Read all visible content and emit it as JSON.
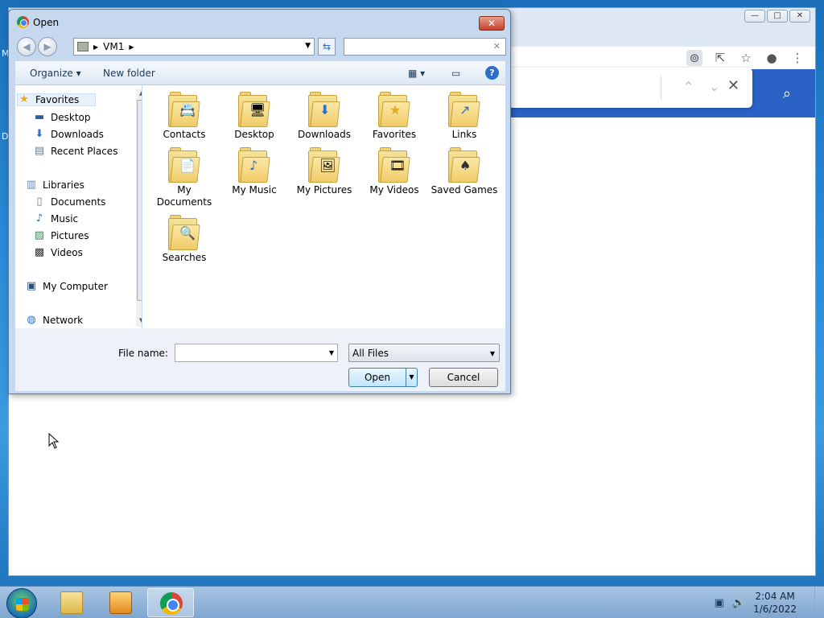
{
  "desktop": {
    "left_letters": [
      "M",
      "D"
    ]
  },
  "chrome_window": {
    "caption": {
      "minimize": "—",
      "maximize": "□",
      "close": "✕"
    },
    "toolbar_icons": [
      "zoom-icon",
      "share-icon",
      "star-icon",
      "profile-icon",
      "menu-icon"
    ],
    "findbar": {
      "up": "⌃",
      "down": "⌄",
      "close": "✕"
    }
  },
  "dialog": {
    "title": "Open",
    "close": "✕",
    "breadcrumb": {
      "location": "VM1"
    },
    "search_placeholder": "",
    "command_bar": {
      "organize": "Organize",
      "new_folder": "New folder",
      "help": "?"
    },
    "nav_pane": {
      "favorites": "Favorites",
      "favorites_items": [
        "Desktop",
        "Downloads",
        "Recent Places"
      ],
      "libraries": "Libraries",
      "libraries_items": [
        "Documents",
        "Music",
        "Pictures",
        "Videos"
      ],
      "computer": "My Computer",
      "network": "Network"
    },
    "folders": [
      {
        "name": "Contacts",
        "glyph": "📇"
      },
      {
        "name": "Desktop",
        "glyph": "🖥"
      },
      {
        "name": "Downloads",
        "glyph": "⬇"
      },
      {
        "name": "Favorites",
        "glyph": "★"
      },
      {
        "name": "Links",
        "glyph": "↗"
      },
      {
        "name": "My Documents",
        "glyph": "📄"
      },
      {
        "name": "My Music",
        "glyph": "♪"
      },
      {
        "name": "My Pictures",
        "glyph": "🖼"
      },
      {
        "name": "My Videos",
        "glyph": "🎞"
      },
      {
        "name": "Saved Games",
        "glyph": "♠"
      },
      {
        "name": "Searches",
        "glyph": "🔍"
      }
    ],
    "file_name_label": "File name:",
    "file_name_value": "",
    "filter_value": "All Files",
    "open_button": "Open",
    "cancel_button": "Cancel"
  },
  "taskbar": {
    "time": "2:04 AM",
    "date": "1/6/2022"
  }
}
